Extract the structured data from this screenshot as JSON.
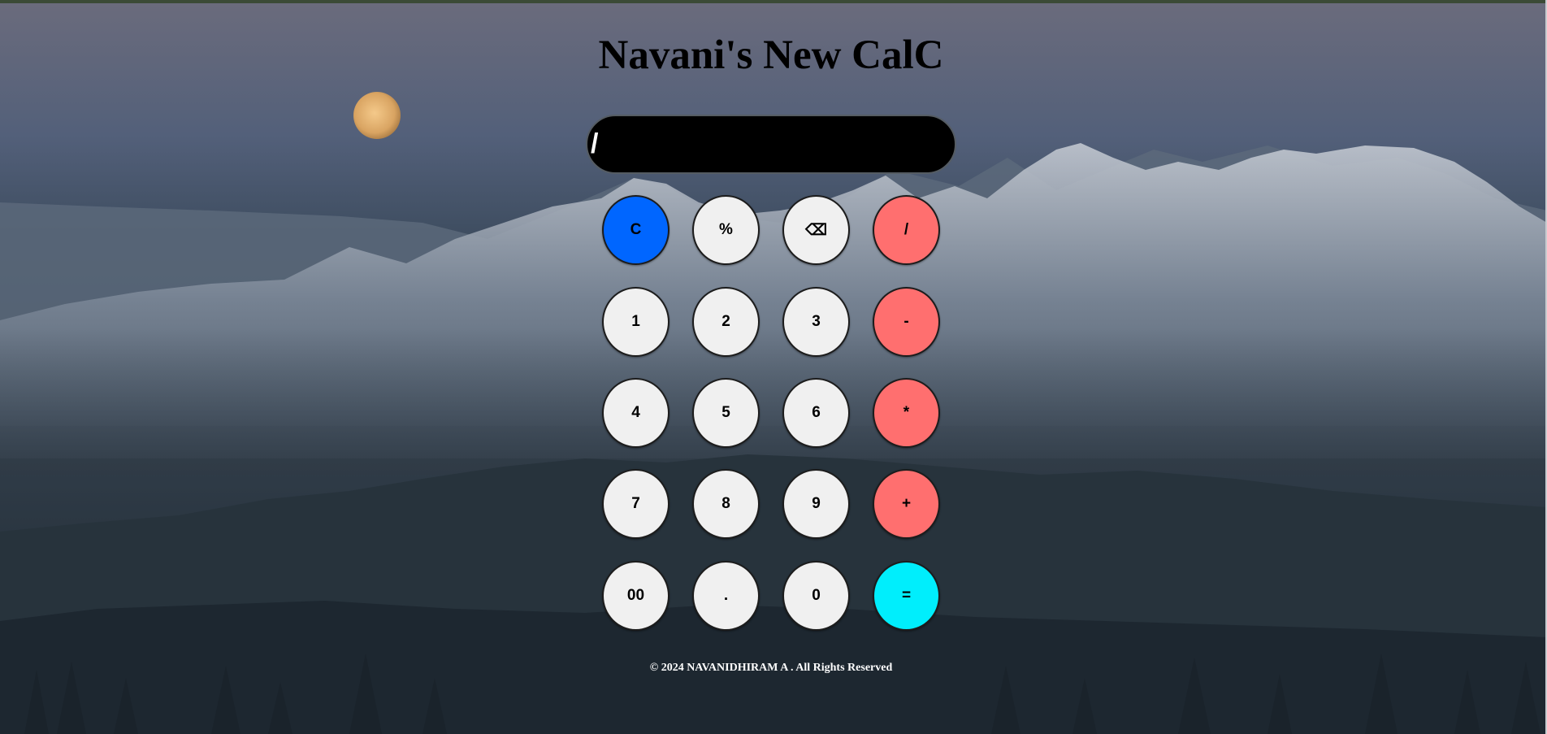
{
  "page": {
    "title": "Navani's New CalC",
    "footer": "© 2024 NAVANIDHIRAM A . All Rights Reserved"
  },
  "display": {
    "value": "/"
  },
  "keys": {
    "clear": "C",
    "percent": "%",
    "backspace": "⌫",
    "divide": "/",
    "one": "1",
    "two": "2",
    "three": "3",
    "minus": "-",
    "four": "4",
    "five": "5",
    "six": "6",
    "multiply": "*",
    "seven": "7",
    "eight": "8",
    "nine": "9",
    "plus": "+",
    "double_zero": "00",
    "dot": ".",
    "zero": "0",
    "equals": "="
  },
  "colors": {
    "clear_key": "#0066ff",
    "operator_key": "#ff6f6f",
    "equals_key": "#00eefc",
    "number_key": "#f0f0f0",
    "display_bg": "#000000"
  }
}
